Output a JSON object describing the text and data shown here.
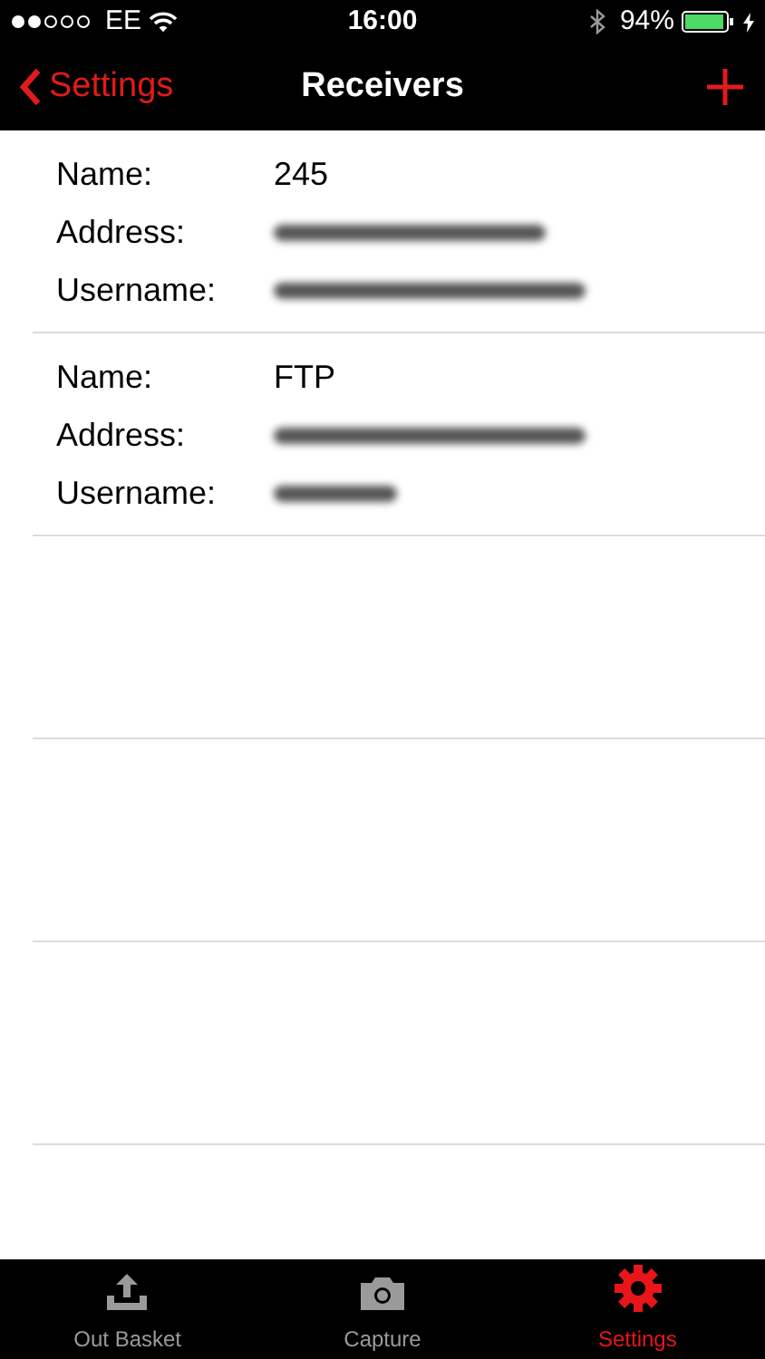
{
  "status_bar": {
    "carrier": "EE",
    "time": "16:00",
    "battery": "94%"
  },
  "nav_bar": {
    "back": "Settings",
    "title": "Receivers"
  },
  "receivers": [
    {
      "fields": [
        {
          "label": "Name:",
          "value": "245",
          "redacted": false
        },
        {
          "label": "Address:",
          "redacted": true
        },
        {
          "label": "Username:",
          "redacted": true
        }
      ]
    },
    {
      "fields": [
        {
          "label": "Name:",
          "value": "FTP",
          "redacted": false
        },
        {
          "label": "Address:",
          "redacted": true
        },
        {
          "label": "Username:",
          "redacted": true
        }
      ]
    }
  ],
  "tabs": [
    {
      "label": "Out Basket",
      "kind": "upload",
      "selected": false
    },
    {
      "label": "Capture",
      "kind": "camera",
      "selected": false
    },
    {
      "label": "Settings",
      "kind": "gear",
      "selected": true
    }
  ]
}
